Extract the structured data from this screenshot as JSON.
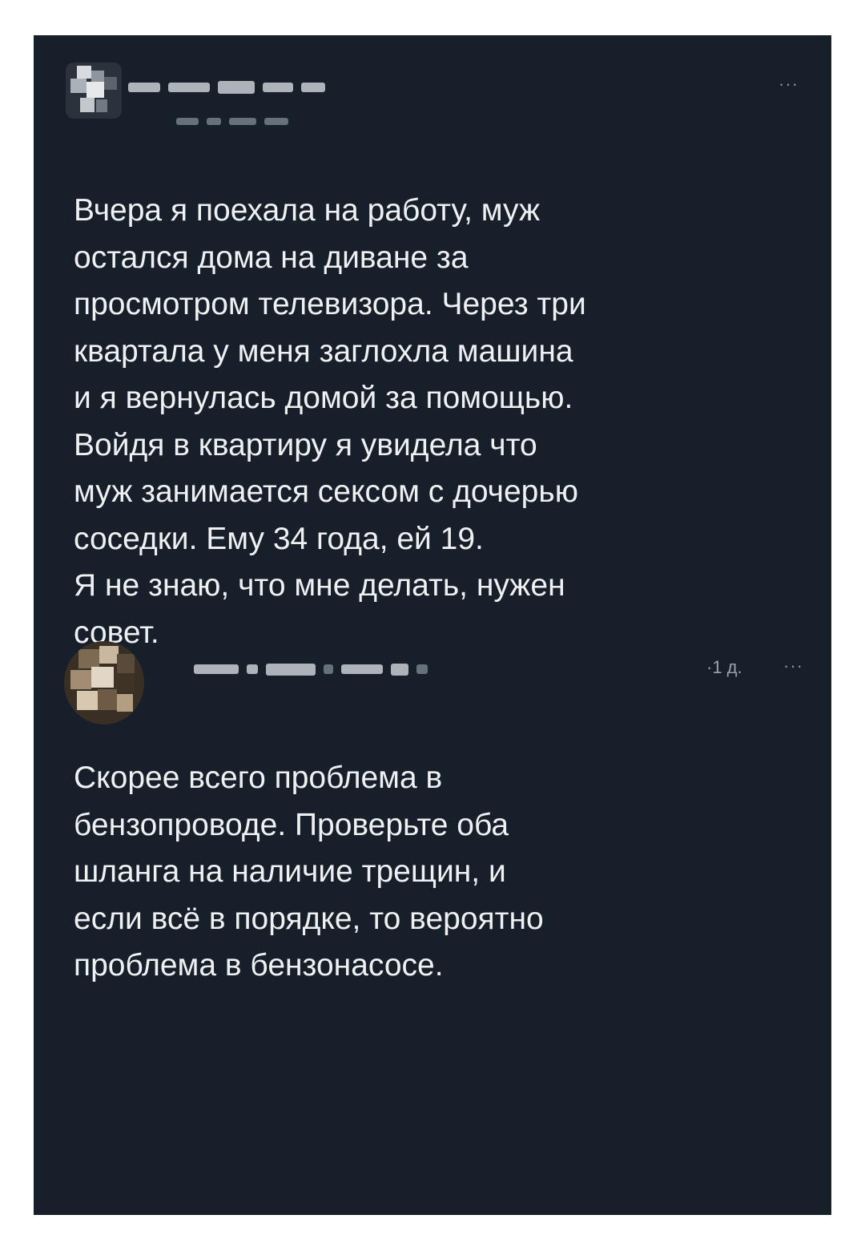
{
  "post": {
    "more_label": "···",
    "text": "Вчера я поехала на работу, муж\nостался дома на диване за\nпросмотром телевизора. Через три\nквартала у меня заглохла машина\nи я вернулась домой за помощью.\nВойдя в квартиру я увидела что\nмуж занимается сексом с дочерью\nсоседки. Ему 34 года, ей 19.\nЯ не знаю, что мне делать, нужен\nсовет."
  },
  "reply": {
    "time": "·1 д.",
    "more_label": "···",
    "text": "Скорее всего проблема в\nбензопроводе. Проверьте оба\nшланга на наличие трещин, и\nесли всё в порядке, то вероятно\nпроблема в бензонасосе."
  },
  "colors": {
    "background": "#17202a",
    "text": "#eef0f2",
    "muted": "#9aa3ad"
  }
}
